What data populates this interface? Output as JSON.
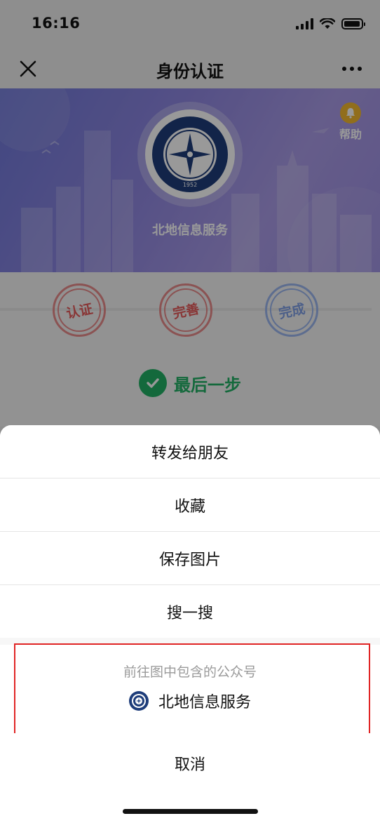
{
  "status_bar": {
    "time": "16:16",
    "icons": [
      "signal-icon",
      "wifi-icon",
      "battery-icon"
    ]
  },
  "navbar": {
    "title": "身份认证",
    "close_icon": "close-icon",
    "more_icon": "more-icon"
  },
  "banner": {
    "logo_text": "1952",
    "title": "北地信息服务",
    "help_label": "帮助"
  },
  "steps": {
    "items": [
      "认证",
      "完善",
      "完成"
    ],
    "last_step": "最后一步"
  },
  "action_sheet": {
    "items": [
      "转发给朋友",
      "收藏",
      "保存图片",
      "搜一搜"
    ],
    "qr_hint": "前往图中包含的公众号",
    "account_name": "北地信息服务",
    "cancel": "取消"
  },
  "colors": {
    "accent_green": "#22b064",
    "highlight_red": "#e02424",
    "banner_purple": "#8e86e0"
  }
}
